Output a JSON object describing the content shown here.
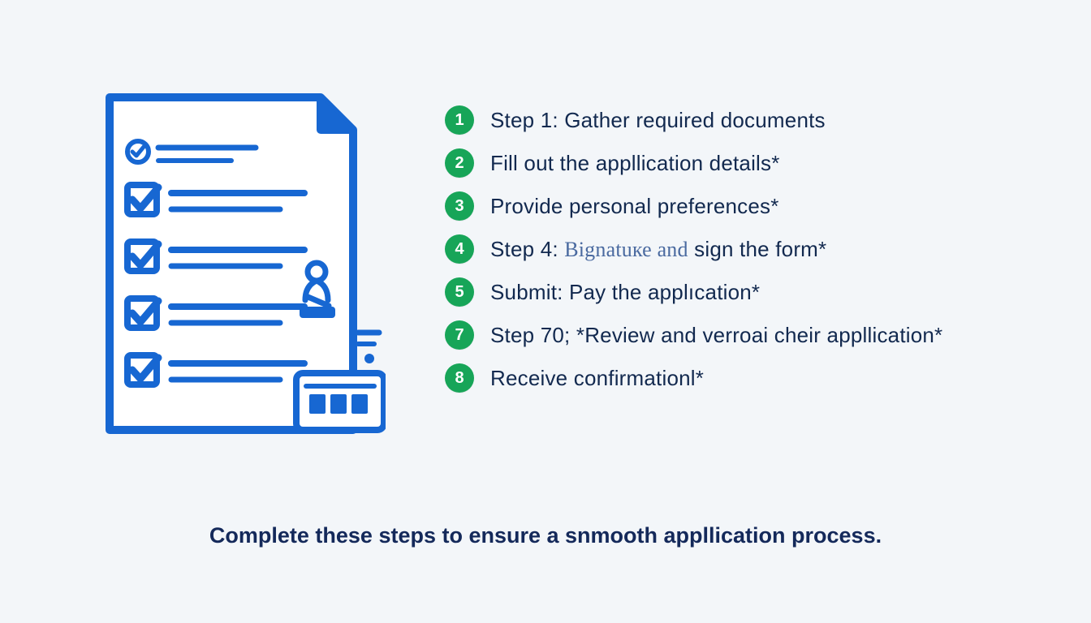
{
  "steps": [
    {
      "num": "1",
      "label": "Step 1: Gather required documents"
    },
    {
      "num": "2",
      "label": "Fill out the appllication details*"
    },
    {
      "num": "3",
      "label": "Provide personal preferences*"
    },
    {
      "num": "4",
      "prefix": "Step 4: ",
      "cursive": "Bignatuке and",
      "suffix": " sign the form*"
    },
    {
      "num": "5",
      "label": "Submit: Pay the applıcation*"
    },
    {
      "num": "7",
      "label": "Step 70; *Review and verroai cheir appllication*"
    },
    {
      "num": "8",
      "label": "Receive confirmationl*"
    }
  ],
  "footer": "Complete these steps to ensure a snmooth appllication process."
}
